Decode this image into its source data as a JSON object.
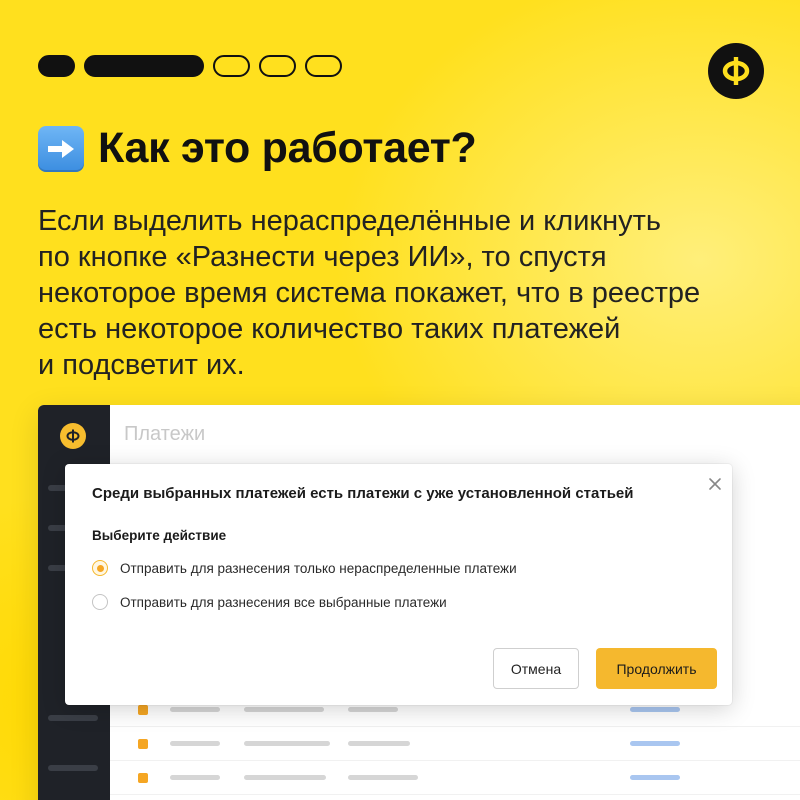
{
  "slide": {
    "progress_steps": [
      {
        "state": "filled",
        "size": "short"
      },
      {
        "state": "filled",
        "size": "long"
      },
      {
        "state": "empty",
        "size": "short"
      },
      {
        "state": "empty",
        "size": "short"
      },
      {
        "state": "empty",
        "size": "short"
      }
    ],
    "logo_glyph": "Ф",
    "heading_icon": "right-arrow-emoji",
    "title": "Как это работает?",
    "description_lines": [
      "Если выделить нераспределённые и кликнуть",
      "по кнопке «Разнести через ИИ», то спустя",
      "некоторое время система покажет, что в реестре",
      "есть некоторое количество таких платежей",
      "и подсветит их."
    ]
  },
  "app": {
    "page_title": "Платежи"
  },
  "modal": {
    "title": "Среди выбранных платежей есть платежи с уже установленной статьей",
    "subtitle": "Выберите действие",
    "options": [
      {
        "label": "Отправить для разнесения только нераспределенные платежи",
        "checked": true
      },
      {
        "label": "Отправить для разнесения все выбранные платежи",
        "checked": false
      }
    ],
    "cancel_label": "Отмена",
    "continue_label": "Продолжить",
    "close_icon": "close-icon"
  },
  "colors": {
    "background": "#FFE01E",
    "accent": "#F5B82E",
    "dark": "#111111",
    "sidebar": "#1F2228"
  }
}
